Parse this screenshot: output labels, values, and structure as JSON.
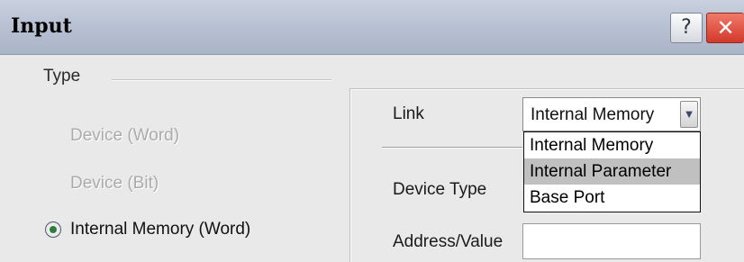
{
  "window": {
    "title": "Input",
    "help_symbol": "?",
    "close_symbol": "✕"
  },
  "type_group": {
    "label": "Type",
    "options": [
      {
        "label": "Device (Word)",
        "enabled": false,
        "selected": false
      },
      {
        "label": "Device (Bit)",
        "enabled": false,
        "selected": false
      },
      {
        "label": "Internal Memory (Word)",
        "enabled": true,
        "selected": true
      }
    ]
  },
  "settings": {
    "link_label": "Link",
    "link_value": "Internal Memory",
    "link_options": [
      "Internal Memory",
      "Internal Parameter",
      "Base Port"
    ],
    "link_highlighted": "Internal Parameter",
    "device_type_label": "Device Type",
    "address_label": "Address/Value",
    "address_value": ""
  },
  "icons": {
    "help": "help-icon",
    "close": "close-icon",
    "dropdown": "chevron-down-icon"
  }
}
